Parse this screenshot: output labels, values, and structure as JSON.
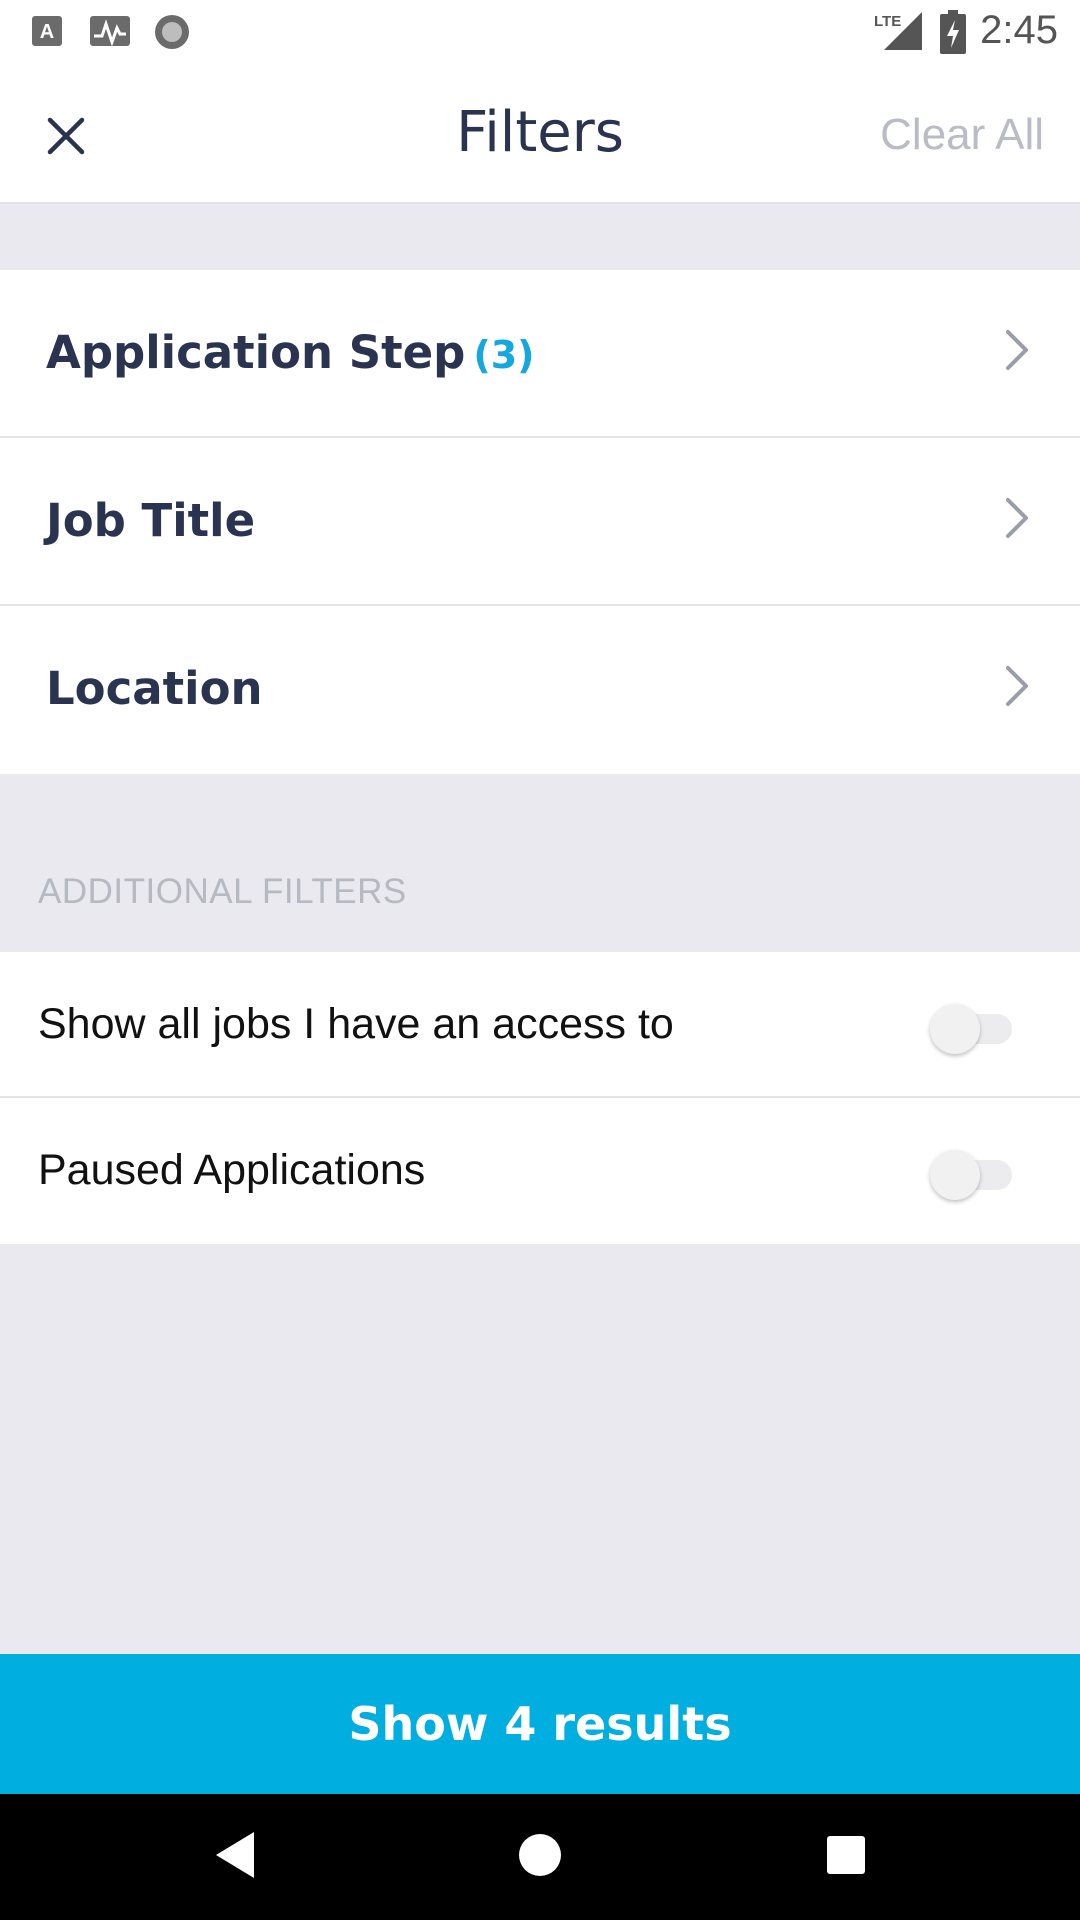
{
  "status_bar": {
    "time": "2:45",
    "network": "LTE",
    "icons": [
      "keyboard-icon",
      "activity-icon",
      "record-icon",
      "signal-icon",
      "battery-charging-icon"
    ]
  },
  "header": {
    "title": "Filters",
    "clear_label": "Clear All",
    "close_icon": "close-icon"
  },
  "filters": [
    {
      "label": "Application Step",
      "count": "(3)"
    },
    {
      "label": "Job Title",
      "count": ""
    },
    {
      "label": "Location",
      "count": ""
    }
  ],
  "additional": {
    "section_label": "ADDITIONAL FILTERS",
    "toggles": [
      {
        "label": "Show all jobs I have an access to",
        "on": false
      },
      {
        "label": "Paused Applications",
        "on": false
      }
    ]
  },
  "cta": {
    "label": "Show 4 results"
  },
  "colors": {
    "accent": "#00afe0",
    "title": "#2a3350",
    "muted": "#b9bcc5",
    "background": "#e9e9ef"
  },
  "nav": {
    "icons": [
      "back-icon",
      "home-icon",
      "recents-icon"
    ]
  }
}
